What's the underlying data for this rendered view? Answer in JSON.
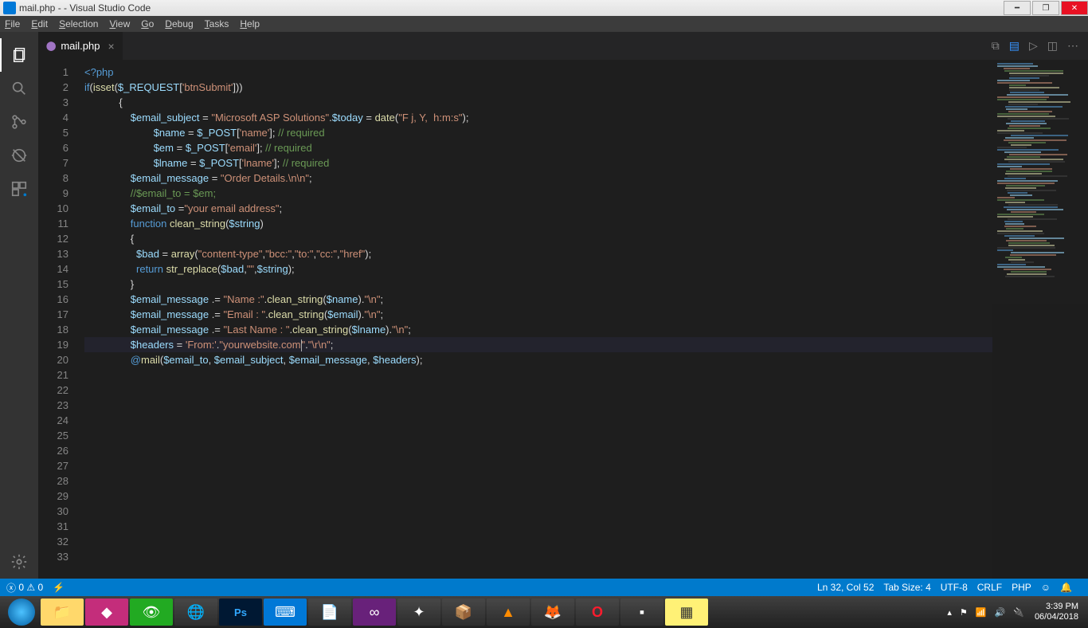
{
  "window": {
    "title": "mail.php -      - Visual Studio Code"
  },
  "menubar": [
    "File",
    "Edit",
    "Selection",
    "View",
    "Go",
    "Debug",
    "Tasks",
    "Help"
  ],
  "tab": {
    "filename": "mail.php"
  },
  "gutter": {
    "start": 1,
    "end": 33
  },
  "code_lines": {
    "1": [
      {
        "c": "sy-tag",
        "t": "<?php"
      }
    ],
    "2": [
      {
        "c": "",
        "t": ""
      }
    ],
    "3": [
      {
        "c": "sy-kw",
        "t": "if"
      },
      {
        "c": "sy-pun",
        "t": "("
      },
      {
        "c": "sy-fn",
        "t": "isset"
      },
      {
        "c": "sy-pun",
        "t": "("
      },
      {
        "c": "sy-var",
        "t": "$_REQUEST"
      },
      {
        "c": "sy-pun",
        "t": "["
      },
      {
        "c": "sy-str",
        "t": "'btnSubmit'"
      },
      {
        "c": "sy-pun",
        "t": "]))"
      }
    ],
    "4": [
      {
        "c": "",
        "t": "            "
      },
      {
        "c": "sy-pun",
        "t": "{"
      }
    ],
    "5": [
      {
        "c": "",
        "t": ""
      }
    ],
    "6": [
      {
        "c": "",
        "t": "                "
      },
      {
        "c": "sy-var",
        "t": "$email_subject"
      },
      {
        "c": "sy-pun",
        "t": " = "
      },
      {
        "c": "sy-str",
        "t": "\"Microsoft ASP Solutions\""
      },
      {
        "c": "sy-pun",
        "t": "."
      },
      {
        "c": "sy-var",
        "t": "$today"
      },
      {
        "c": "sy-pun",
        "t": " = "
      },
      {
        "c": "sy-fn",
        "t": "date"
      },
      {
        "c": "sy-pun",
        "t": "("
      },
      {
        "c": "sy-str",
        "t": "\"F j, Y,  h:m:s\""
      },
      {
        "c": "sy-pun",
        "t": ");"
      }
    ],
    "7": [
      {
        "c": "",
        "t": ""
      }
    ],
    "8": [
      {
        "c": "",
        "t": ""
      }
    ],
    "9": [
      {
        "c": "",
        "t": "                        "
      },
      {
        "c": "sy-var",
        "t": "$name"
      },
      {
        "c": "sy-pun",
        "t": " = "
      },
      {
        "c": "sy-var",
        "t": "$_POST"
      },
      {
        "c": "sy-pun",
        "t": "["
      },
      {
        "c": "sy-str",
        "t": "'name'"
      },
      {
        "c": "sy-pun",
        "t": "]; "
      },
      {
        "c": "sy-cmt",
        "t": "// required"
      }
    ],
    "10": [
      {
        "c": "",
        "t": "                        "
      },
      {
        "c": "sy-var",
        "t": "$em"
      },
      {
        "c": "sy-pun",
        "t": " = "
      },
      {
        "c": "sy-var",
        "t": "$_POST"
      },
      {
        "c": "sy-pun",
        "t": "["
      },
      {
        "c": "sy-str",
        "t": "'email'"
      },
      {
        "c": "sy-pun",
        "t": "]; "
      },
      {
        "c": "sy-cmt",
        "t": "// required"
      }
    ],
    "11": [
      {
        "c": "",
        "t": "                        "
      },
      {
        "c": "sy-var",
        "t": "$lname"
      },
      {
        "c": "sy-pun",
        "t": " = "
      },
      {
        "c": "sy-var",
        "t": "$_POST"
      },
      {
        "c": "sy-pun",
        "t": "["
      },
      {
        "c": "sy-str",
        "t": "'lname'"
      },
      {
        "c": "sy-pun",
        "t": "]; "
      },
      {
        "c": "sy-cmt",
        "t": "// required"
      }
    ],
    "12": [
      {
        "c": "",
        "t": ""
      }
    ],
    "13": [
      {
        "c": "",
        "t": "                "
      },
      {
        "c": "sy-var",
        "t": "$email_message"
      },
      {
        "c": "sy-pun",
        "t": " = "
      },
      {
        "c": "sy-str",
        "t": "\"Order Details.\\n\\n\""
      },
      {
        "c": "sy-pun",
        "t": ";"
      }
    ],
    "14": [
      {
        "c": "",
        "t": ""
      }
    ],
    "15": [
      {
        "c": "",
        "t": "                "
      },
      {
        "c": "sy-cmt",
        "t": "//$email_to = $em;"
      }
    ],
    "16": [
      {
        "c": "",
        "t": "                "
      },
      {
        "c": "sy-var",
        "t": "$email_to"
      },
      {
        "c": "sy-pun",
        "t": " ="
      },
      {
        "c": "sy-str",
        "t": "\"your email address\""
      },
      {
        "c": "sy-pun",
        "t": ";"
      }
    ],
    "17": [
      {
        "c": "",
        "t": ""
      }
    ],
    "18": [
      {
        "c": "",
        "t": ""
      }
    ],
    "19": [
      {
        "c": "",
        "t": "                "
      },
      {
        "c": "sy-kw",
        "t": "function"
      },
      {
        "c": "",
        "t": " "
      },
      {
        "c": "sy-fn",
        "t": "clean_string"
      },
      {
        "c": "sy-pun",
        "t": "("
      },
      {
        "c": "sy-var",
        "t": "$string"
      },
      {
        "c": "sy-pun",
        "t": ")"
      }
    ],
    "20": [
      {
        "c": "",
        "t": "                "
      },
      {
        "c": "sy-pun",
        "t": "{"
      }
    ],
    "21": [
      {
        "c": "",
        "t": "                  "
      },
      {
        "c": "sy-var",
        "t": "$bad"
      },
      {
        "c": "sy-pun",
        "t": " = "
      },
      {
        "c": "sy-fn",
        "t": "array"
      },
      {
        "c": "sy-pun",
        "t": "("
      },
      {
        "c": "sy-str",
        "t": "\"content-type\""
      },
      {
        "c": "sy-pun",
        "t": ","
      },
      {
        "c": "sy-str",
        "t": "\"bcc:\""
      },
      {
        "c": "sy-pun",
        "t": ","
      },
      {
        "c": "sy-str",
        "t": "\"to:\""
      },
      {
        "c": "sy-pun",
        "t": ","
      },
      {
        "c": "sy-str",
        "t": "\"cc:\""
      },
      {
        "c": "sy-pun",
        "t": ","
      },
      {
        "c": "sy-str",
        "t": "\"href\""
      },
      {
        "c": "sy-pun",
        "t": ");"
      }
    ],
    "22": [
      {
        "c": "",
        "t": "                  "
      },
      {
        "c": "sy-kw",
        "t": "return"
      },
      {
        "c": "",
        "t": " "
      },
      {
        "c": "sy-fn",
        "t": "str_replace"
      },
      {
        "c": "sy-pun",
        "t": "("
      },
      {
        "c": "sy-var",
        "t": "$bad"
      },
      {
        "c": "sy-pun",
        "t": ","
      },
      {
        "c": "sy-str",
        "t": "\"\""
      },
      {
        "c": "sy-pun",
        "t": ","
      },
      {
        "c": "sy-var",
        "t": "$string"
      },
      {
        "c": "sy-pun",
        "t": ");"
      }
    ],
    "23": [
      {
        "c": "",
        "t": "                "
      },
      {
        "c": "sy-pun",
        "t": "}"
      }
    ],
    "24": [
      {
        "c": "",
        "t": ""
      }
    ],
    "25": [
      {
        "c": "",
        "t": "                "
      },
      {
        "c": "sy-var",
        "t": "$email_message"
      },
      {
        "c": "sy-pun",
        "t": " .= "
      },
      {
        "c": "sy-str",
        "t": "\"Name :\""
      },
      {
        "c": "sy-pun",
        "t": "."
      },
      {
        "c": "sy-fn",
        "t": "clean_string"
      },
      {
        "c": "sy-pun",
        "t": "("
      },
      {
        "c": "sy-var",
        "t": "$name"
      },
      {
        "c": "sy-pun",
        "t": ")."
      },
      {
        "c": "sy-str",
        "t": "\"\\n\""
      },
      {
        "c": "sy-pun",
        "t": ";"
      }
    ],
    "26": [
      {
        "c": "",
        "t": ""
      }
    ],
    "27": [
      {
        "c": "",
        "t": "                "
      },
      {
        "c": "sy-var",
        "t": "$email_message"
      },
      {
        "c": "sy-pun",
        "t": " .= "
      },
      {
        "c": "sy-str",
        "t": "\"Email : \""
      },
      {
        "c": "sy-pun",
        "t": "."
      },
      {
        "c": "sy-fn",
        "t": "clean_string"
      },
      {
        "c": "sy-pun",
        "t": "("
      },
      {
        "c": "sy-var",
        "t": "$email"
      },
      {
        "c": "sy-pun",
        "t": ")."
      },
      {
        "c": "sy-str",
        "t": "\"\\n\""
      },
      {
        "c": "sy-pun",
        "t": ";"
      }
    ],
    "28": [
      {
        "c": "",
        "t": ""
      }
    ],
    "29": [
      {
        "c": "",
        "t": "                "
      },
      {
        "c": "sy-var",
        "t": "$email_message"
      },
      {
        "c": "sy-pun",
        "t": " .= "
      },
      {
        "c": "sy-str",
        "t": "\"Last Name : \""
      },
      {
        "c": "sy-pun",
        "t": "."
      },
      {
        "c": "sy-fn",
        "t": "clean_string"
      },
      {
        "c": "sy-pun",
        "t": "("
      },
      {
        "c": "sy-var",
        "t": "$lname"
      },
      {
        "c": "sy-pun",
        "t": ")."
      },
      {
        "c": "sy-str",
        "t": "\"\\n\""
      },
      {
        "c": "sy-pun",
        "t": ";"
      }
    ],
    "30": [
      {
        "c": "",
        "t": ""
      }
    ],
    "31": [
      {
        "c": "",
        "t": ""
      }
    ],
    "32": [
      {
        "c": "",
        "t": "                "
      },
      {
        "c": "sy-var",
        "t": "$headers"
      },
      {
        "c": "sy-pun",
        "t": " = "
      },
      {
        "c": "sy-str",
        "t": "'From:'"
      },
      {
        "c": "sy-pun",
        "t": "."
      },
      {
        "c": "sy-str",
        "t": "\"yourwebsite.com"
      },
      {
        "c": "cursor",
        "t": ""
      },
      {
        "c": "sy-str",
        "t": "\""
      },
      {
        "c": "sy-pun",
        "t": "."
      },
      {
        "c": "sy-str",
        "t": "\"\\r\\n\""
      },
      {
        "c": "sy-pun",
        "t": ";"
      }
    ],
    "33": [
      {
        "c": "",
        "t": "                "
      },
      {
        "c": "sy-at",
        "t": "@"
      },
      {
        "c": "sy-fn",
        "t": "mail"
      },
      {
        "c": "sy-pun",
        "t": "("
      },
      {
        "c": "sy-var",
        "t": "$email_to"
      },
      {
        "c": "sy-pun",
        "t": ", "
      },
      {
        "c": "sy-var",
        "t": "$email_subject"
      },
      {
        "c": "sy-pun",
        "t": ", "
      },
      {
        "c": "sy-var",
        "t": "$email_message"
      },
      {
        "c": "sy-pun",
        "t": ", "
      },
      {
        "c": "sy-var",
        "t": "$headers"
      },
      {
        "c": "sy-pun",
        "t": ");"
      }
    ]
  },
  "statusbar": {
    "errors": "0",
    "warnings": "0",
    "lncol": "Ln 32, Col 52",
    "tabsize": "Tab Size: 4",
    "encoding": "UTF-8",
    "eol": "CRLF",
    "lang": "PHP"
  },
  "systray": {
    "time": "3:39 PM",
    "date": "06/04/2018"
  }
}
